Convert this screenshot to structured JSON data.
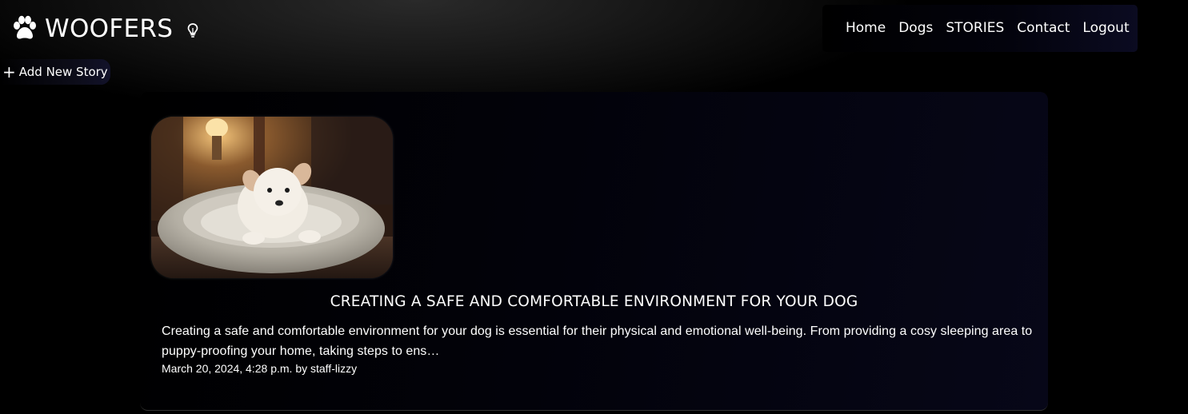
{
  "brand": {
    "title": "WOOFERS",
    "icon": "paw-icon",
    "theme_toggle_icon": "lightbulb-icon"
  },
  "nav": {
    "items": [
      {
        "label": "Home"
      },
      {
        "label": "Dogs"
      },
      {
        "label": "STORIES"
      },
      {
        "label": "Contact"
      },
      {
        "label": "Logout"
      }
    ]
  },
  "actions": {
    "add_story_label": "Add New Story",
    "add_story_icon": "plus-icon"
  },
  "stories": [
    {
      "title": "CREATING A SAFE AND COMFORTABLE ENVIRONMENT FOR YOUR DOG",
      "excerpt": "Creating a safe and comfortable environment for your dog is essential for their physical and emotional well-being. From providing a cosy sleeping area to puppy-proofing your home, taking steps to ens…",
      "meta": "March 20, 2024, 4:28 p.m. by staff-lizzy",
      "image_alt": "Puppy lying in a dog bed"
    }
  ],
  "colors": {
    "background": "#000000",
    "text": "#ffffff",
    "card_accent": "#070718"
  }
}
